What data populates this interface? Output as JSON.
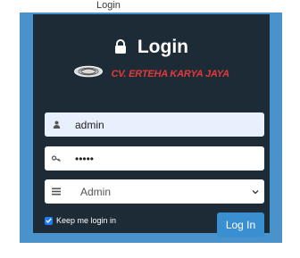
{
  "page": {
    "top_text": "Login"
  },
  "login": {
    "title": "Login",
    "brand_name": "CV. ERTEHA KARYA JAYA",
    "username_value": "admin",
    "password_value": "•••••",
    "role_selected": "Admin",
    "remember_label": "Keep me login in",
    "remember_checked": true,
    "submit_label": "Log In"
  },
  "icons": {
    "title": "lock-icon",
    "username": "user-icon",
    "password": "key-icon",
    "role": "list-icon",
    "dropdown": "chevron-down-icon",
    "checkbox": "check-icon"
  },
  "colors": {
    "outer_frame": "#4a92cb",
    "panel": "#1d2b36",
    "brand_text": "#e33a3a",
    "button": "#3a8fd1",
    "checkbox": "#1e7cf2",
    "username_field": "#e9f0fd"
  }
}
